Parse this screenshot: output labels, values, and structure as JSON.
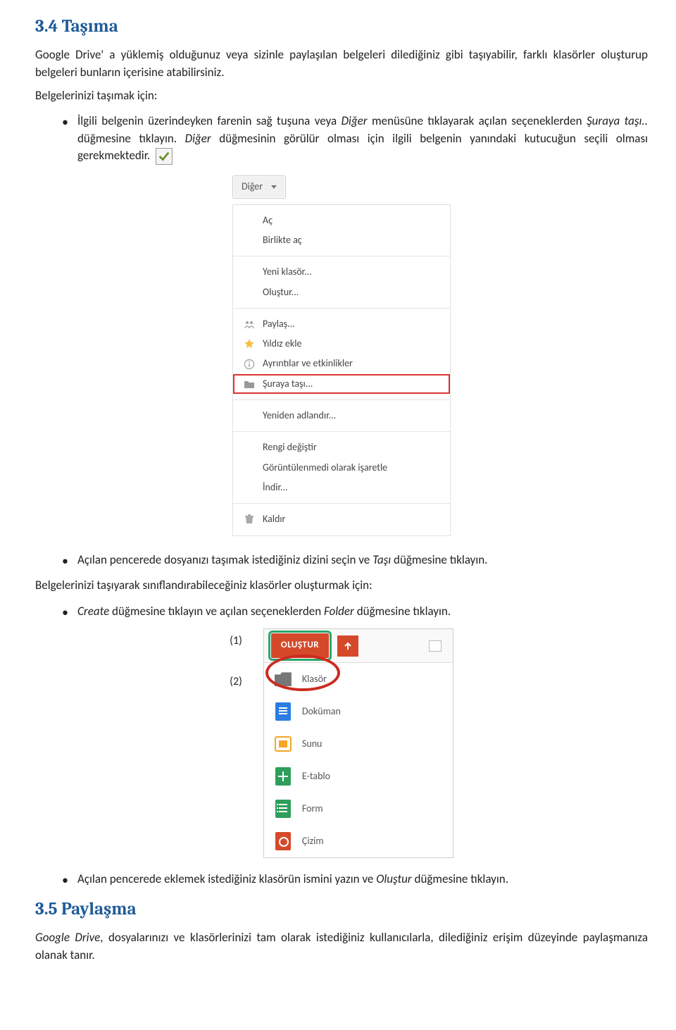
{
  "h1": "3.4 Taşıma",
  "intro1": "Google Drive' a yüklemiş olduğunuz veya sizinle paylaşılan belgeleri dilediğiniz gibi taşıyabilir, farklı klasörler oluşturup belgeleri bunların içerisine atabilirsiniz.",
  "intro2": "Belgelerinizi taşımak için:",
  "bullet1a": "İlgili belgenin üzerindeyken farenin sağ tuşuna veya ",
  "bullet1b": "Diğer",
  "bullet1c": " menüsüne tıklayarak açılan seçeneklerden ",
  "bullet1d": "Şuraya taşı..",
  "bullet1e": " düğmesine tıklayın. ",
  "bullet1f": "Diğer",
  "bullet1g": " düğmesinin görülür olması için ilgili belgenin yanındaki kutucuğun seçili olması gerekmektedir.",
  "diger_button": "Diğer",
  "menu": {
    "g1": [
      "Aç",
      "Birlikte aç"
    ],
    "g2": [
      "Yeni klasör...",
      "Oluştur..."
    ],
    "g3": [
      {
        "icon": "share",
        "label": "Paylaş..."
      },
      {
        "icon": "star",
        "label": "Yıldız ekle"
      },
      {
        "icon": "info",
        "label": "Ayrıntılar ve etkinlikler"
      },
      {
        "icon": "folder",
        "label": "Şuraya taşı...",
        "highlight": true
      }
    ],
    "g4": [
      "Yeniden adlandır..."
    ],
    "g5": [
      "Rengi değiştir",
      "Görüntülenmedi olarak işaretle",
      "İndir..."
    ],
    "g6": [
      {
        "icon": "trash",
        "label": "Kaldır"
      }
    ]
  },
  "bullet2a": "Açılan pencerede dosyanızı taşımak istediğiniz dizini seçin ve ",
  "bullet2b": "Taşı",
  "bullet2c": " düğmesine tıklayın.",
  "intro3": "Belgelerinizi taşıyarak sınıflandırabileceğiniz klasörler oluşturmak için:",
  "bullet3a": "Create",
  "bullet3b": " düğmesine tıklayın ve açılan seçeneklerden ",
  "bullet3c": "Folder",
  "bullet3d": " düğmesine tıklayın.",
  "num1": "(1)",
  "num2": "(2)",
  "olustur_btn": "OLUŞTUR",
  "create_items": [
    {
      "type": "folder",
      "label": "Klasör"
    },
    {
      "type": "doc",
      "label": "Doküman"
    },
    {
      "type": "slide",
      "label": "Sunu"
    },
    {
      "type": "sheet",
      "label": "E-tablo"
    },
    {
      "type": "form",
      "label": "Form"
    },
    {
      "type": "draw",
      "label": "Çizim"
    }
  ],
  "bullet4a": "Açılan pencerede eklemek istediğiniz klasörün ismini yazın ve ",
  "bullet4b": "Oluştur",
  "bullet4c": " düğmesine tıklayın.",
  "h2": "3.5 Paylaşma",
  "p5a": "Google Drive",
  "p5b": ", dosyalarınızı ve klasörlerinizi tam olarak istediğiniz kullanıcılarla, dilediğiniz erişim düzeyinde paylaşmanıza olanak tanır."
}
